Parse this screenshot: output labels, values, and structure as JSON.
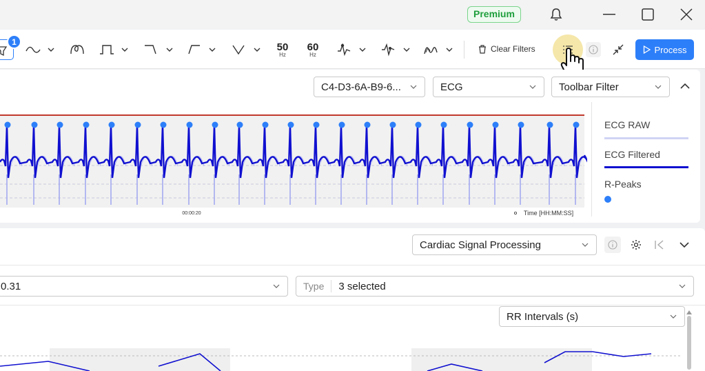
{
  "titlebar": {
    "premium_label": "Premium",
    "icons": [
      "bell-icon",
      "minimize-icon",
      "maximize-icon",
      "close-icon"
    ]
  },
  "toolbar": {
    "filter_badge": "1",
    "notch_50": {
      "value": "50",
      "unit": "Hz"
    },
    "notch_60": {
      "value": "60",
      "unit": "Hz"
    },
    "clear_filters_label": "Clear Filters",
    "process_label": "Process"
  },
  "ecg_panel": {
    "device_select": "C4-D3-6A-B9-6...",
    "signal_select": "ECG",
    "filter_select": "Toolbar Filter",
    "time_tick": "00:00:20",
    "time_axis_label": "Time [HH:MM:SS]",
    "legend": [
      {
        "label": "ECG RAW",
        "color": "#d0d4f5"
      },
      {
        "label": "ECG Filtered",
        "color": "#1010d0"
      },
      {
        "label": "R-Peaks",
        "color": "#2d7ff9"
      }
    ],
    "threshold_color": "#c0392b"
  },
  "processing_panel": {
    "method_select": "Cardiac Signal Processing",
    "value_field": "0.31",
    "type_label": "Type",
    "type_value": "3 selected",
    "metric_select": "RR Intervals (s)"
  },
  "colors": {
    "accent": "#2d7ff9",
    "premium_green": "#1e9e3c",
    "ecg_filtered": "#1010d0"
  }
}
